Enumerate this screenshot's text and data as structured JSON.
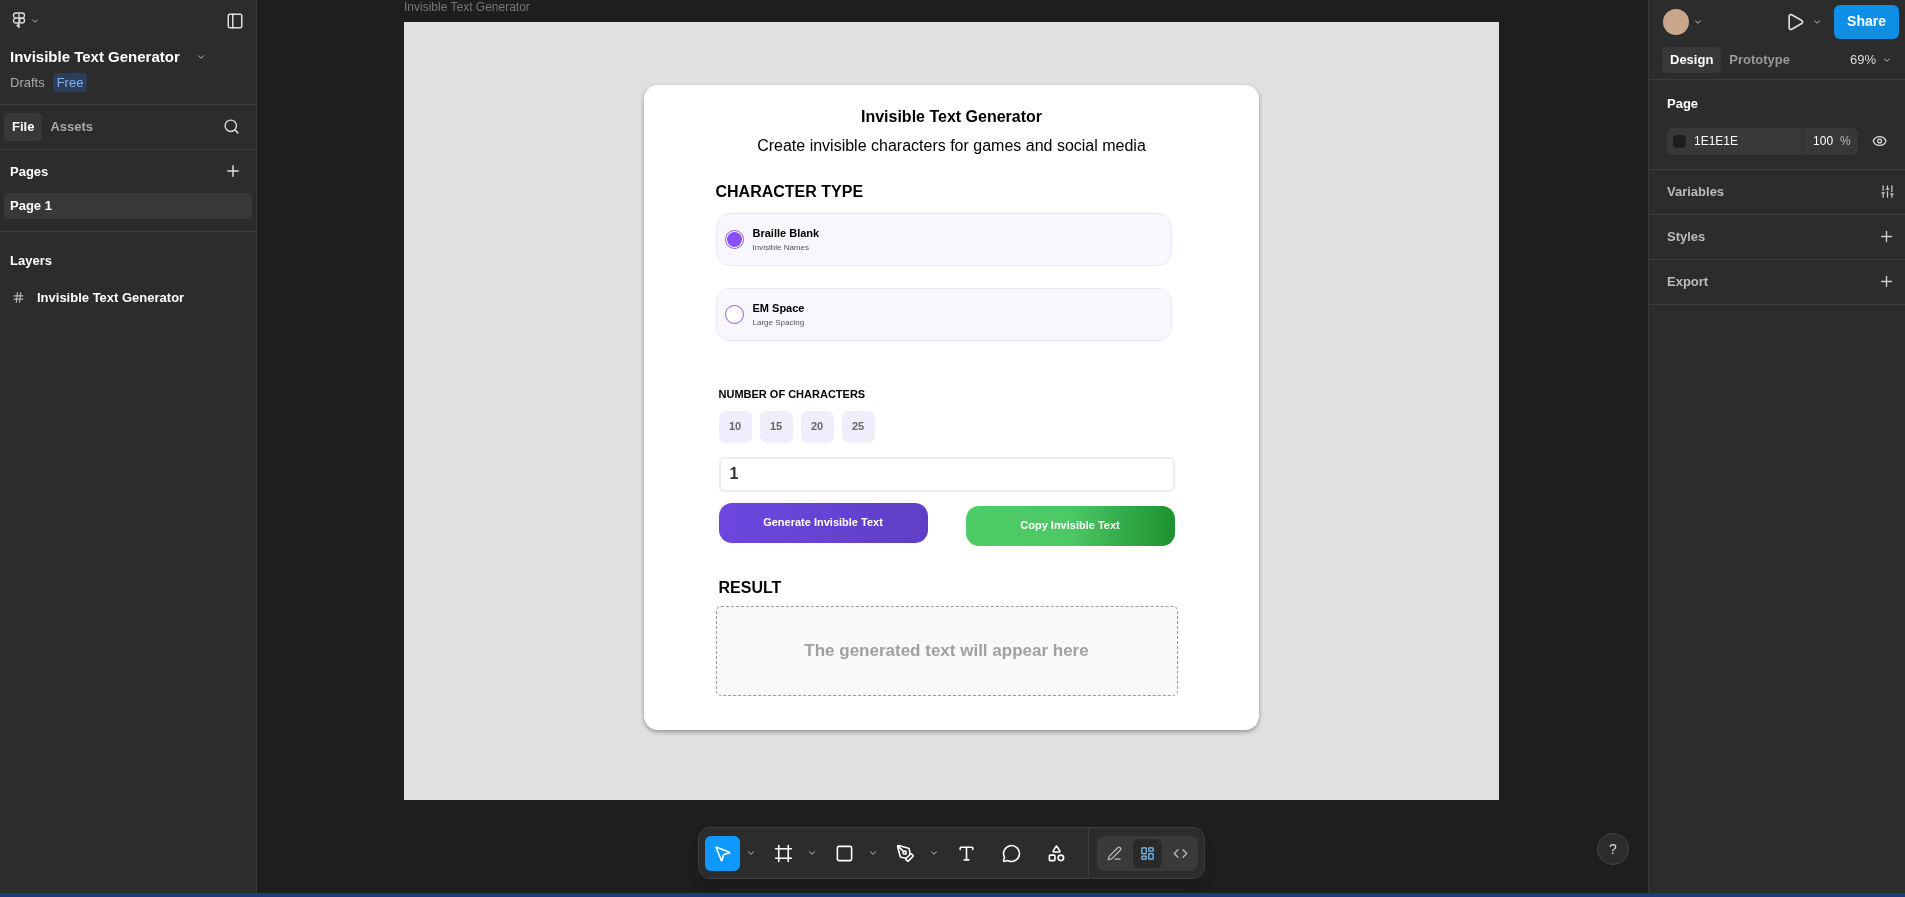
{
  "file": {
    "title": "Invisible Text Generator",
    "location": "Drafts",
    "plan": "Free"
  },
  "left_tabs": [
    {
      "label": "File",
      "selected": true
    },
    {
      "label": "Assets",
      "selected": false
    }
  ],
  "pages": {
    "title": "Pages",
    "items": [
      {
        "label": "Page 1",
        "selected": true
      }
    ]
  },
  "layers": {
    "title": "Layers",
    "items": [
      {
        "label": "Invisible Text Generator"
      }
    ]
  },
  "share": "Share",
  "right_tabs": [
    {
      "label": "Design",
      "selected": true
    },
    {
      "label": "Prototype",
      "selected": false
    }
  ],
  "zoom": "69%",
  "page_section": {
    "title": "Page",
    "color": "1E1E1E",
    "opacity": "100",
    "unit": "%"
  },
  "sections": [
    {
      "label": "Variables",
      "kind": "variables"
    },
    {
      "label": "Styles",
      "kind": "add"
    },
    {
      "label": "Export",
      "kind": "add"
    }
  ],
  "frame": {
    "name": "Invisible Text Generator",
    "title": "Invisible Text Generator",
    "subtitle": "Create invisible characters for games and social media",
    "type_heading": "CHARACTER TYPE",
    "options": [
      {
        "name": "Braille Blank",
        "description": "Invisible Names",
        "selected": true
      },
      {
        "name": "EM Space",
        "description": "Large Spacing",
        "selected": false
      }
    ],
    "count_heading": "NUMBER OF CHARACTERS",
    "presets": [
      "10",
      "15",
      "20",
      "25"
    ],
    "count_value": "1",
    "buttons": [
      {
        "label": "Generate Invisible Text",
        "kind": "generate"
      },
      {
        "label": "Copy Invisible Text",
        "kind": "copy"
      }
    ],
    "result_heading": "RESULT",
    "result_text": "The generated text will appear here"
  },
  "toolbar": {
    "tools": [
      {
        "kind": "move",
        "selected": true,
        "menu": true
      },
      {
        "kind": "frame",
        "selected": false,
        "menu": true
      },
      {
        "kind": "shape",
        "selected": false,
        "menu": true
      },
      {
        "kind": "pen",
        "selected": false,
        "menu": true
      },
      {
        "kind": "text",
        "selected": false,
        "menu": false
      },
      {
        "kind": "comment",
        "selected": false,
        "menu": false
      },
      {
        "kind": "components",
        "selected": false,
        "menu": false
      }
    ],
    "modes": [
      {
        "kind": "draw",
        "selected": false
      },
      {
        "kind": "design",
        "selected": true
      },
      {
        "kind": "dev",
        "selected": false
      }
    ]
  },
  "help": "?"
}
